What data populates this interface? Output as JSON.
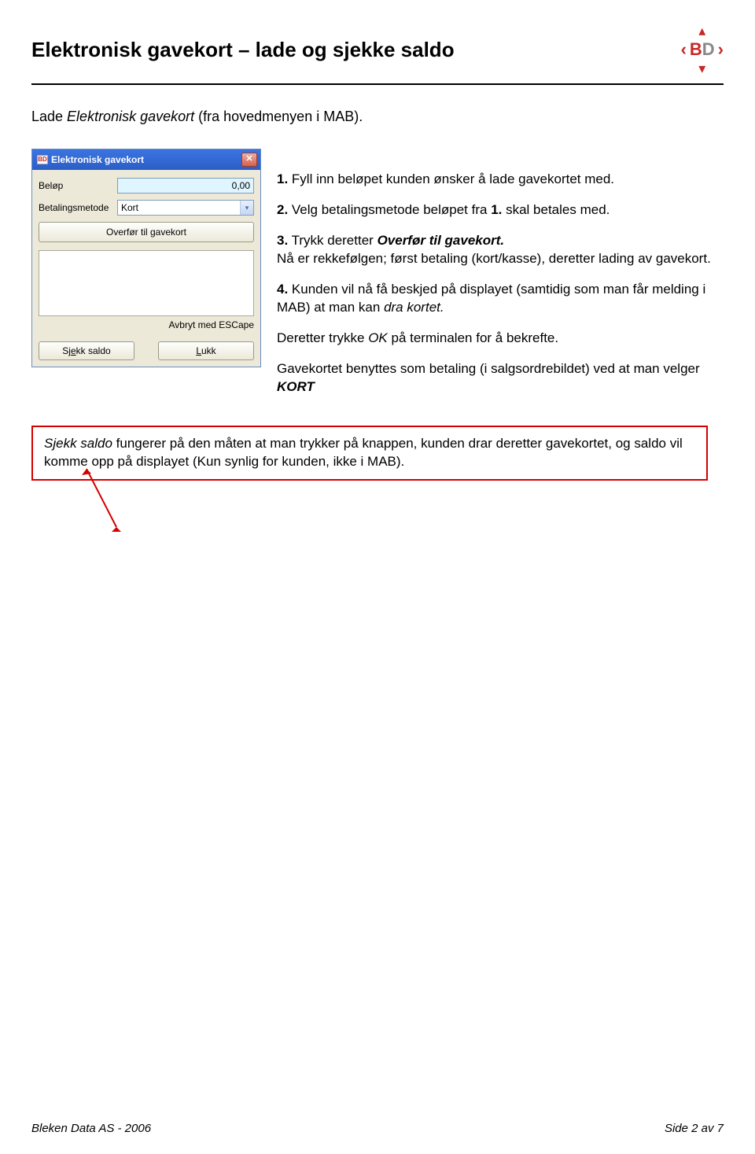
{
  "header": {
    "title": "Elektronisk gavekort – lade og sjekke saldo"
  },
  "intro_prefix": "Lade ",
  "intro_italic": "Elektronisk gavekort",
  "intro_suffix": " (fra hovedmenyen i MAB).",
  "dialog": {
    "title": "Elektronisk gavekort",
    "labels": {
      "amount": "Beløp",
      "method": "Betalingsmetode"
    },
    "amount_value": "0,00",
    "method_value": "Kort",
    "transfer_btn": "Overfør til gavekort",
    "esc_label": "Avbryt med ESCape",
    "check_btn_prefix": "Sj",
    "check_btn_u": "e",
    "check_btn_suffix": "kk saldo",
    "close_btn_u": "L",
    "close_btn_suffix": "ukk"
  },
  "steps": {
    "s1": {
      "n": "1.",
      "t": " Fyll inn beløpet kunden ønsker å lade gavekortet med."
    },
    "s2": {
      "n": "2.",
      "t_a": " Velg betalingsmetode beløpet fra ",
      "b": "1.",
      "t_b": " skal betales med."
    },
    "s3": {
      "n": "3.",
      "t_a": " Trykk deretter ",
      "bi": "Overfør til gavekort.",
      "t_b": "Nå er rekkefølgen; først betaling (kort/kasse), deretter lading av gavekort."
    },
    "s4": {
      "n": "4.",
      "t_a": " Kunden vil nå få beskjed på displayet (samtidig som man får melding i MAB) at man kan ",
      "i": "dra kortet.",
      "t_b": "Deretter trykke ",
      "i2": "OK",
      "t_c": " på terminalen for å bekrefte."
    },
    "s5": {
      "t_a": "Gavekortet benyttes som betaling (i salgsordrebildet) ved at man velger ",
      "bi": "KORT"
    }
  },
  "callout": {
    "i": "Sjekk saldo",
    "t": " fungerer på den måten at man trykker på knappen, kunden drar deretter gavekortet, og saldo vil komme opp på displayet (Kun synlig for kunden, ikke i MAB)."
  },
  "footer": {
    "left": "Bleken Data AS - 2006",
    "right": "Side 2 av 7"
  }
}
